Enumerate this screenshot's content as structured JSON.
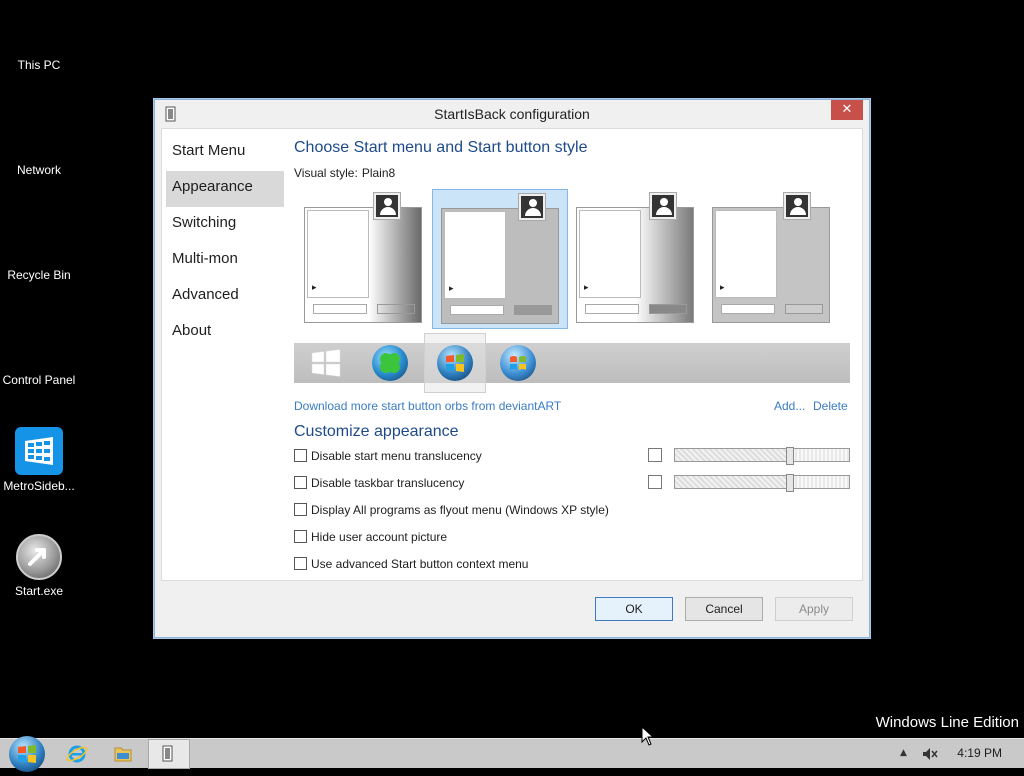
{
  "desktop": {
    "icons": [
      {
        "label": "This PC"
      },
      {
        "label": "Network"
      },
      {
        "label": "Recycle Bin"
      },
      {
        "label": "Control Panel"
      },
      {
        "label": "MetroSideb..."
      },
      {
        "label": "Start.exe"
      }
    ],
    "watermark": "Windows Line Edition"
  },
  "window": {
    "title": "StartIsBack configuration",
    "close_glyph": "✕",
    "nav": [
      {
        "label": "Start Menu"
      },
      {
        "label": "Appearance"
      },
      {
        "label": "Switching"
      },
      {
        "label": "Multi-mon"
      },
      {
        "label": "Advanced"
      },
      {
        "label": "About"
      }
    ],
    "active_nav": "Appearance",
    "style_section": {
      "heading": "Choose Start menu and Start button style",
      "visual_style_label": "Visual style:",
      "visual_style_value": "Plain8",
      "selected_style_index": 1,
      "download_link": "Download more start button orbs from deviantART",
      "add_link": "Add...",
      "delete_link": "Delete"
    },
    "customize_section": {
      "heading": "Customize appearance",
      "options": [
        {
          "label": "Disable start menu translucency",
          "checked": false
        },
        {
          "label": "Disable taskbar translucency",
          "checked": false
        },
        {
          "label": "Display All programs as flyout menu (Windows XP style)",
          "checked": false
        },
        {
          "label": "Hide user account picture",
          "checked": false
        },
        {
          "label": "Use advanced Start button context menu",
          "checked": false
        }
      ],
      "translucency_levels": [
        0.66,
        0.66
      ]
    },
    "buttons": {
      "ok": "OK",
      "cancel": "Cancel",
      "apply": "Apply"
    }
  },
  "taskbar": {
    "clock": "4:19 PM",
    "icons": [
      "windows-orb-icon",
      "internet-explorer-icon",
      "file-explorer-icon",
      "startisback-config-icon"
    ]
  },
  "colors": {
    "accent_link": "#3a7cc4",
    "heading": "#1e4a8a",
    "close_red": "#c7504b",
    "selection": "#cce4f7"
  }
}
